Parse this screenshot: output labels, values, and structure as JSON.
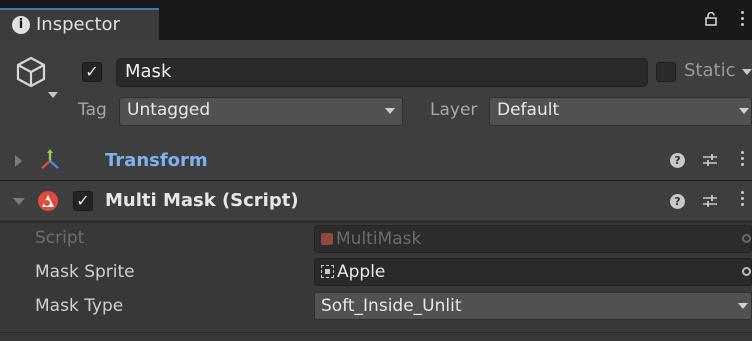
{
  "tab": {
    "label": "Inspector",
    "icon": "info-icon"
  },
  "header": {
    "active": true,
    "object_name": "Mask",
    "static_label": "Static",
    "static_checked": false,
    "tag_label": "Tag",
    "tag_value": "Untagged",
    "layer_label": "Layer",
    "layer_value": "Default"
  },
  "components": [
    {
      "title": "Transform",
      "expanded": false,
      "title_color": "#7db1f0"
    },
    {
      "title": "Multi Mask (Script)",
      "expanded": true,
      "enabled": true,
      "title_color": "#e6e6e6"
    }
  ],
  "properties": [
    {
      "label": "Script",
      "value": "MultiMask",
      "disabled": true
    },
    {
      "label": "Mask Sprite",
      "value": "Apple"
    },
    {
      "label": "Mask Type",
      "value": "Soft_Inside_Unlit"
    }
  ],
  "colors": {
    "accent": "#3a79bb",
    "panel": "#383838",
    "header": "#3e3e3e"
  }
}
